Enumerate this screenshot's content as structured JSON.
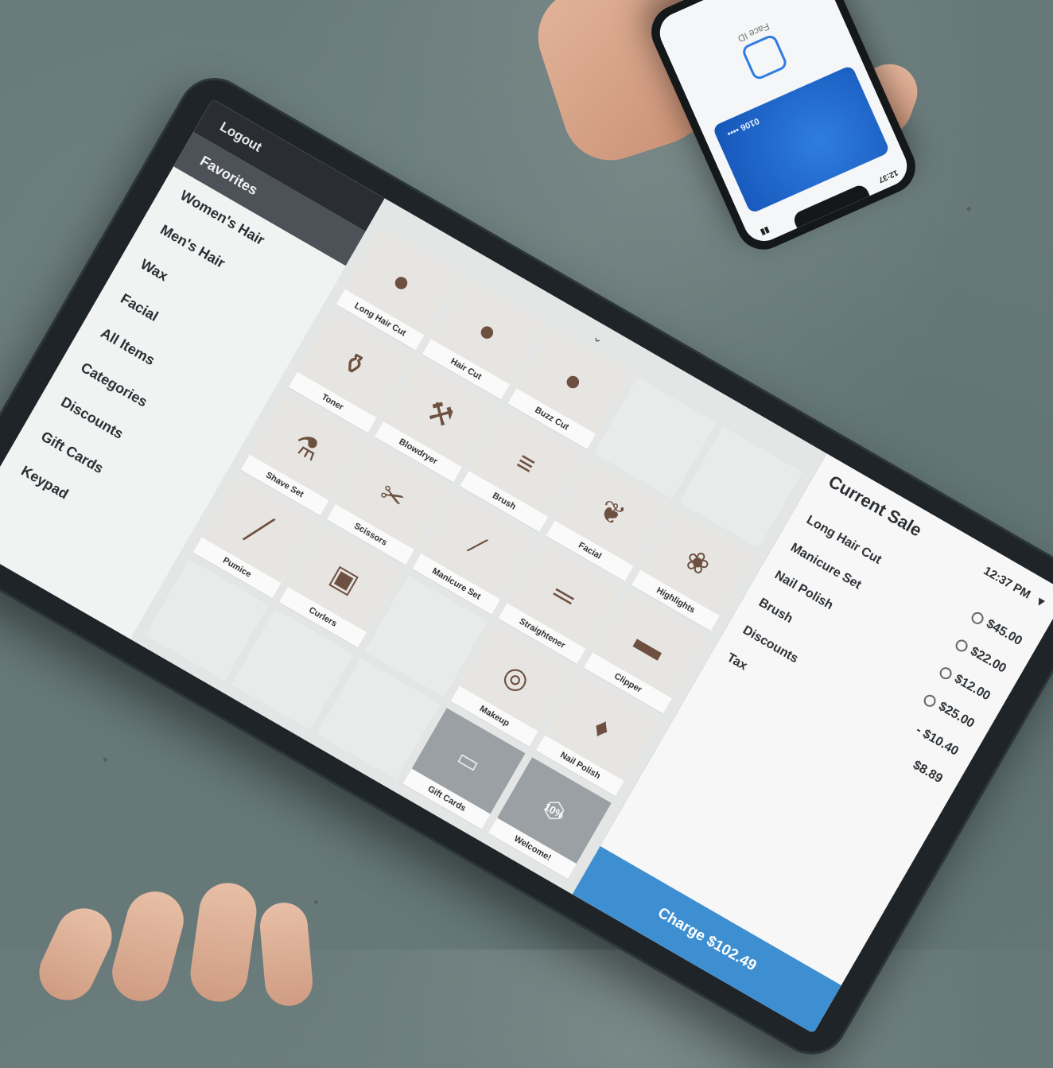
{
  "device": {
    "sidebar": {
      "logout": "Logout",
      "items": [
        {
          "label": "Favorites",
          "active": true
        },
        {
          "label": "Women's Hair"
        },
        {
          "label": "Men's Hair"
        },
        {
          "label": "Wax"
        },
        {
          "label": "Facial"
        },
        {
          "label": "All Items"
        },
        {
          "label": "Categories"
        },
        {
          "label": "Discounts"
        },
        {
          "label": "Gift Cards"
        },
        {
          "label": "Keypad"
        }
      ]
    },
    "grid": {
      "rows": [
        [
          {
            "name": "Long Hair Cut",
            "icon": "hair-icon"
          },
          {
            "name": "Hair Cut",
            "icon": "hair-icon"
          },
          {
            "name": "Buzz Cut",
            "icon": "hair-icon"
          },
          {
            "name": "",
            "empty": true
          },
          {
            "name": "",
            "empty": true
          }
        ],
        [
          {
            "name": "Toner",
            "icon": "bottle-icon"
          },
          {
            "name": "Blowdryer",
            "icon": "dryer-icon"
          },
          {
            "name": "Brush",
            "icon": "brush-icon"
          },
          {
            "name": "Facial",
            "icon": "facial-icon"
          },
          {
            "name": "Highlights",
            "icon": "highlights-icon"
          }
        ],
        [
          {
            "name": "Shave Set",
            "icon": "shave-icon"
          },
          {
            "name": "Scissors",
            "icon": "scissors-icon"
          },
          {
            "name": "Manicure Set",
            "icon": "manicure-icon"
          },
          {
            "name": "Straightener",
            "icon": "straightener-icon"
          },
          {
            "name": "Clipper",
            "icon": "clipper-icon"
          }
        ],
        [
          {
            "name": "Pumice",
            "icon": "pumice-icon"
          },
          {
            "name": "Curlers",
            "icon": "curlers-icon"
          },
          {
            "name": "",
            "empty": true
          },
          {
            "name": "Makeup",
            "icon": "makeup-icon"
          },
          {
            "name": "Nail Polish",
            "icon": "polish-icon"
          }
        ],
        [
          {
            "name": "",
            "empty": true
          },
          {
            "name": "",
            "empty": true
          },
          {
            "name": "",
            "empty": true
          },
          {
            "name": "Gift Cards",
            "icon": "gift-card-icon",
            "special": true
          },
          {
            "name": "Welcome!",
            "icon": "tag-icon",
            "special": true,
            "badge": "10%"
          }
        ]
      ]
    },
    "sale": {
      "title": "Current Sale",
      "time": "12:37 PM",
      "lines": [
        {
          "label": "Long Hair Cut",
          "amount": "$45.00"
        },
        {
          "label": "Manicure Set",
          "amount": "$22.00"
        },
        {
          "label": "Nail Polish",
          "amount": "$12.00"
        },
        {
          "label": "Brush",
          "amount": "$25.00"
        },
        {
          "label": "Discounts",
          "amount": "- $10.40"
        },
        {
          "label": "Tax",
          "amount": "$8.89"
        }
      ],
      "charge": "Charge $102.49"
    }
  },
  "phone": {
    "time": "12:37",
    "card_number": "0106 ••••",
    "faceid_label": "Face ID"
  },
  "colors": {
    "charge": "#3d8fd1",
    "sidebar_active": "#4c5257",
    "logout_bar": "#2a2e33",
    "card": "#1d66cc"
  }
}
